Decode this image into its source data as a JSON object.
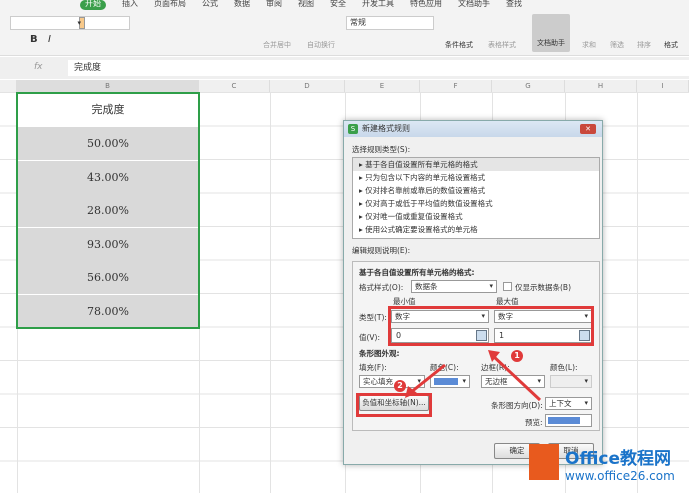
{
  "menu": [
    "开始",
    "插入",
    "页面布局",
    "公式",
    "数据",
    "审阅",
    "视图",
    "安全",
    "开发工具",
    "特色应用",
    "文档助手",
    "查找"
  ],
  "toolbar": {
    "number_format": "常规",
    "merge": "合并居中",
    "wrap": "自动换行",
    "cond_format": "条件格式",
    "table_style": "表格样式",
    "doc_helper": "文档助手",
    "sum": "求和",
    "filter": "筛选",
    "sort": "排序",
    "format": "格式"
  },
  "formula_bar": {
    "fx": "fx",
    "value": "完成度"
  },
  "columns": [
    "B",
    "C",
    "D",
    "E",
    "F",
    "G",
    "H",
    "I"
  ],
  "sheet": {
    "header": "完成度",
    "values": [
      "50.00%",
      "43.00%",
      "28.00%",
      "93.00%",
      "56.00%",
      "78.00%"
    ]
  },
  "dialog": {
    "title": "新建格式规则",
    "select_type_label": "选择规则类型(S):",
    "rule_types": [
      "基于各自值设置所有单元格的格式",
      "只为包含以下内容的单元格设置格式",
      "仅对排名靠前或靠后的数值设置格式",
      "仅对高于或低于平均值的数值设置格式",
      "仅对唯一值或重复值设置格式",
      "使用公式确定要设置格式的单元格"
    ],
    "edit_label": "编辑规则说明(E):",
    "section_title": "基于各自值设置所有单元格的格式:",
    "format_style_label": "格式样式(O):",
    "format_style": "数据条",
    "show_bar_only": "仅显示数据条(B)",
    "min_label": "最小值",
    "max_label": "最大值",
    "type_label": "类型(T):",
    "min_type": "数字",
    "max_type": "数字",
    "value_label": "值(V):",
    "min_value": "0",
    "max_value": "1",
    "appearance_label": "条形图外观:",
    "fill_label": "填充(F):",
    "fill": "实心填充",
    "color_label": "颜色(C):",
    "fill_color": "#5b8bd6",
    "border_label": "边框(R):",
    "border": "无边框",
    "border_color_label": "颜色(L):",
    "negative_button": "负值和坐标轴(N)...",
    "direction_label": "条形图方向(D):",
    "direction": "上下文",
    "preview_label": "预览:",
    "ok": "确定",
    "cancel": "取消"
  },
  "annotations": [
    "1",
    "2"
  ],
  "watermark": {
    "line1": "Office教程网",
    "line2": "www.office26.com"
  }
}
